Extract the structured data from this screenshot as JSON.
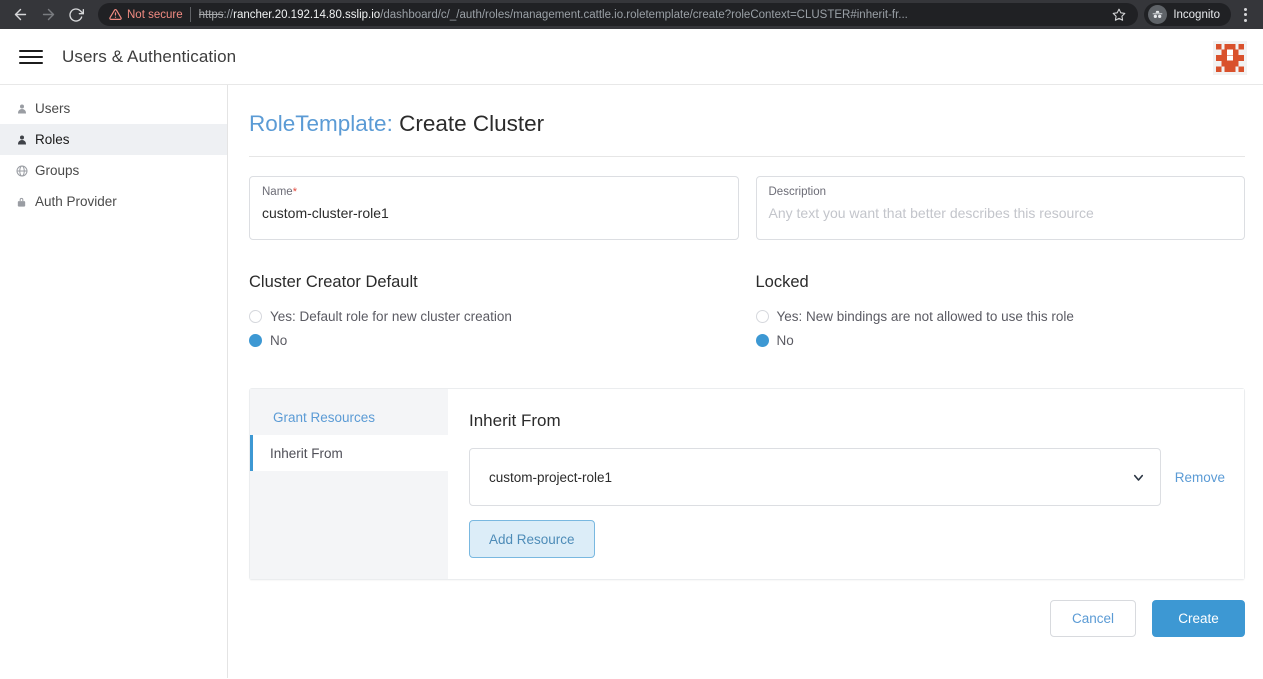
{
  "browser": {
    "back_icon": "arrow-left-icon",
    "forward_icon": "arrow-right-icon",
    "reload_icon": "reload-icon",
    "security_warning_icon": "warning-triangle-icon",
    "security_label": "Not secure",
    "url_scheme": "https",
    "url_separator": "://",
    "url_host": "rancher.20.192.14.80.sslip.io",
    "url_path": "/dashboard/c/_/auth/roles/management.cattle.io.roletemplate/create?roleContext=CLUSTER#inherit-fr...",
    "bookmark_icon": "star-icon",
    "profile_icon": "incognito-icon",
    "profile_label": "Incognito",
    "menu_icon": "kebab-menu-icon"
  },
  "header": {
    "menu_icon": "hamburger-icon",
    "title": "Users & Authentication",
    "logo_icon": "rancher-logo-icon",
    "logo_color": "#d9512c"
  },
  "sidebar": {
    "items": [
      {
        "label": "Users",
        "icon": "person-icon",
        "active": false
      },
      {
        "label": "Roles",
        "icon": "person-icon",
        "active": true
      },
      {
        "label": "Groups",
        "icon": "globe-icon",
        "active": false
      },
      {
        "label": "Auth Provider",
        "icon": "lock-icon",
        "active": false
      }
    ]
  },
  "page": {
    "title_prefix": "RoleTemplate:",
    "title_main": "Create Cluster"
  },
  "form": {
    "name": {
      "label": "Name",
      "required_marker": "*",
      "value": "custom-cluster-role1"
    },
    "description": {
      "label": "Description",
      "value": "",
      "placeholder": "Any text you want that better describes this resource"
    }
  },
  "cluster_creator_default": {
    "heading": "Cluster Creator Default",
    "options": [
      {
        "label": "Yes: Default role for new cluster creation",
        "selected": false
      },
      {
        "label": "No",
        "selected": true
      }
    ]
  },
  "locked": {
    "heading": "Locked",
    "options": [
      {
        "label": "Yes: New bindings are not allowed to use this role",
        "selected": false
      },
      {
        "label": "No",
        "selected": true
      }
    ]
  },
  "tabs": [
    {
      "label": "Grant Resources",
      "active": false
    },
    {
      "label": "Inherit From",
      "active": true
    }
  ],
  "inherit_from": {
    "heading": "Inherit From",
    "select_value": "custom-project-role1",
    "chevron_icon": "chevron-down-icon",
    "remove_label": "Remove",
    "add_resource_label": "Add Resource"
  },
  "footer": {
    "cancel_label": "Cancel",
    "create_label": "Create"
  },
  "colors": {
    "accent_blue": "#3d98d3",
    "link_blue": "#5b9bd5",
    "danger_red": "#e1483c",
    "brand_orange": "#d9512c"
  }
}
